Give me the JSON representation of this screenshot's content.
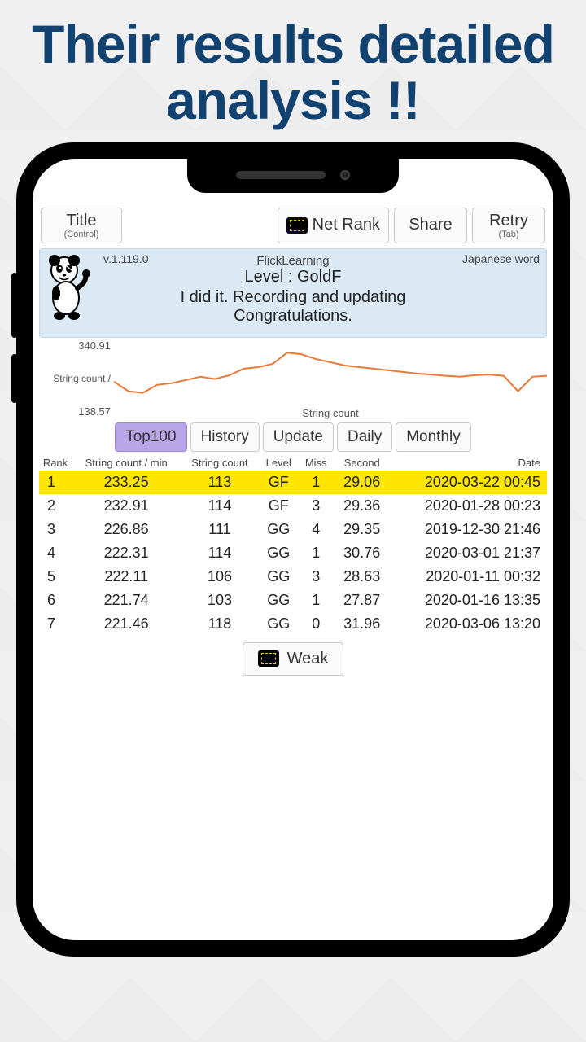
{
  "headline": "Their results detailed analysis !!",
  "toolbar": {
    "title_label": "Title",
    "title_sub": "(Control)",
    "netrank_label": "Net Rank",
    "share_label": "Share",
    "retry_label": "Retry",
    "retry_sub": "(Tab)"
  },
  "info": {
    "version": "v.1.119.0",
    "app_name": "FlickLearning",
    "language": "Japanese word",
    "level": "Level : GoldF",
    "message_line1": "I did it. Recording and updating",
    "message_line2": "Congratulations."
  },
  "chart_data": {
    "type": "line",
    "title": "",
    "xlabel": "String count",
    "ylabel": "String count /",
    "ylim": [
      138.57,
      340.91
    ],
    "tick_top": "340.91",
    "tick_bottom": "138.57",
    "values": [
      210,
      180,
      175,
      200,
      205,
      215,
      225,
      218,
      230,
      250,
      255,
      265,
      300,
      295,
      280,
      270,
      260,
      255,
      250,
      245,
      240,
      235,
      232,
      228,
      225,
      230,
      232,
      228,
      180,
      225,
      228
    ]
  },
  "tabs": {
    "items": [
      "Top100",
      "History",
      "Update",
      "Daily",
      "Monthly"
    ],
    "active_index": 0
  },
  "table": {
    "headers": {
      "rank": "Rank",
      "spm": "String count / min",
      "count": "String count",
      "level": "Level",
      "miss": "Miss",
      "second": "Second",
      "date": "Date"
    },
    "rows": [
      {
        "rank": "1",
        "spm": "233.25",
        "count": "113",
        "level": "GF",
        "miss": "1",
        "second": "29.06",
        "date": "2020-03-22 00:45",
        "hi": true
      },
      {
        "rank": "2",
        "spm": "232.91",
        "count": "114",
        "level": "GF",
        "miss": "3",
        "second": "29.36",
        "date": "2020-01-28 00:23"
      },
      {
        "rank": "3",
        "spm": "226.86",
        "count": "111",
        "level": "GG",
        "miss": "4",
        "second": "29.35",
        "date": "2019-12-30 21:46"
      },
      {
        "rank": "4",
        "spm": "222.31",
        "count": "114",
        "level": "GG",
        "miss": "1",
        "second": "30.76",
        "date": "2020-03-01 21:37"
      },
      {
        "rank": "5",
        "spm": "222.11",
        "count": "106",
        "level": "GG",
        "miss": "3",
        "second": "28.63",
        "date": "2020-01-11 00:32"
      },
      {
        "rank": "6",
        "spm": "221.74",
        "count": "103",
        "level": "GG",
        "miss": "1",
        "second": "27.87",
        "date": "2020-01-16 13:35"
      },
      {
        "rank": "7",
        "spm": "221.46",
        "count": "118",
        "level": "GG",
        "miss": "0",
        "second": "31.96",
        "date": "2020-03-06 13:20"
      }
    ]
  },
  "weak_label": "Weak"
}
